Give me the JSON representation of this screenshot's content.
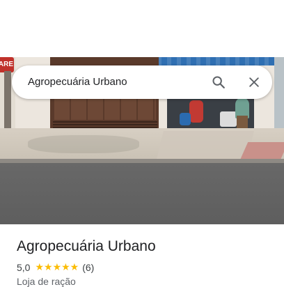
{
  "search": {
    "query": "Agropecuária Urbano",
    "search_icon": "search-icon",
    "close_icon": "close-icon"
  },
  "photo": {
    "sign_text": "PARE"
  },
  "place": {
    "name": "Agropecuária Urbano",
    "rating_value": "5,0",
    "stars_display": "★★★★★",
    "rating": 5.0,
    "review_count": "(6)",
    "category": "Loja de ração"
  },
  "colors": {
    "star": "#fbbc04",
    "text_primary": "#202124",
    "text_secondary": "#5f6368"
  }
}
